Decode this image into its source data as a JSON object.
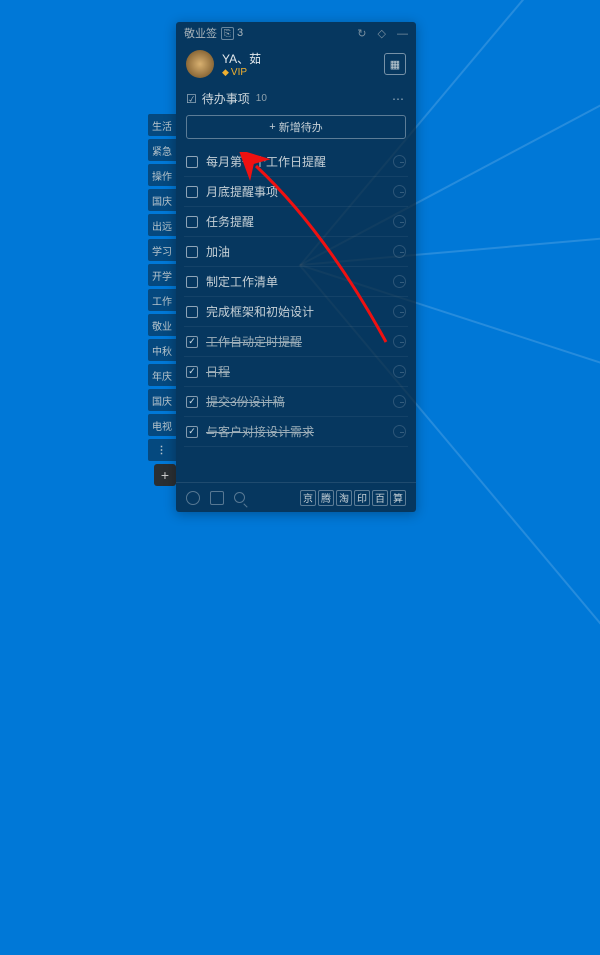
{
  "titlebar": {
    "app_name": "敬业签",
    "badge": "",
    "count": "3"
  },
  "user": {
    "name": "YA、茹",
    "vip": "VIP"
  },
  "section": {
    "title": "待办事项",
    "count": "10",
    "add_label": "新增待办"
  },
  "side_tags": [
    "生活",
    "紧急",
    "操作",
    "国庆",
    "出远",
    "学习",
    "开学",
    "工作",
    "敬业",
    "中秋",
    "年庆",
    "国庆",
    "电视"
  ],
  "todos": [
    {
      "text": "每月第一个工作日提醒",
      "done": false
    },
    {
      "text": "月底提醒事项",
      "done": false
    },
    {
      "text": "任务提醒",
      "done": false
    },
    {
      "text": "加油",
      "done": false
    },
    {
      "text": "制定工作清单",
      "done": false
    },
    {
      "text": "完成框架和初始设计",
      "done": false
    },
    {
      "text": "工作自动定时提醒",
      "done": true
    },
    {
      "text": "日程",
      "done": true
    },
    {
      "text": "提交3份设计稿",
      "done": true
    },
    {
      "text": "与客户对接设计需求",
      "done": true
    }
  ],
  "footer_chips": [
    "京",
    "腾",
    "淘",
    "印",
    "百",
    "算"
  ]
}
